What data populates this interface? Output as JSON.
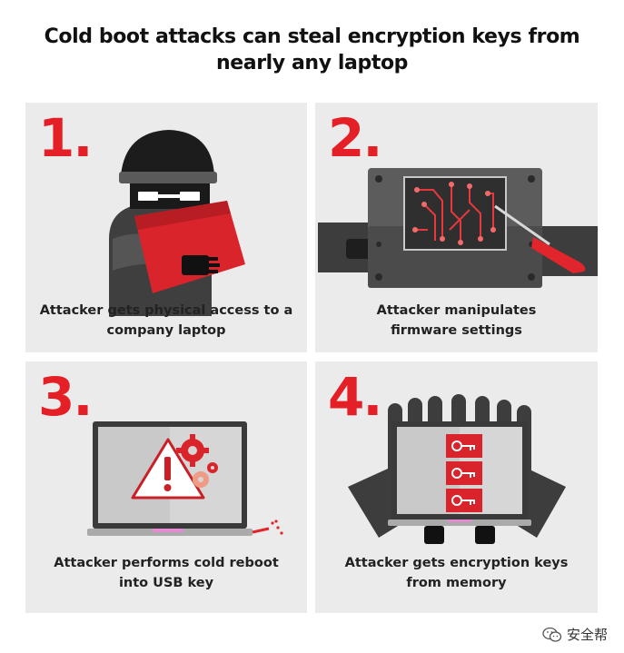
{
  "title_line1": "Cold boot attacks can steal encryption keys from",
  "title_line2": "nearly any laptop",
  "steps": [
    {
      "number": "1.",
      "caption_line1": "Attacker gets physical access to a",
      "caption_line2": "company laptop"
    },
    {
      "number": "2.",
      "caption_line1": "Attacker manipulates",
      "caption_line2": "firmware settings"
    },
    {
      "number": "3.",
      "caption_line1": "Attacker performs cold reboot",
      "caption_line2": "into USB key"
    },
    {
      "number": "4.",
      "caption_line1": "Attacker gets encryption keys",
      "caption_line2": "from memory"
    }
  ],
  "watermark": {
    "text": "安全帮",
    "icon": "wechat-icon"
  },
  "colors": {
    "accent_red": "#e41f26",
    "dark_gray": "#3d3d3d",
    "panel_bg": "#ebebeb"
  }
}
